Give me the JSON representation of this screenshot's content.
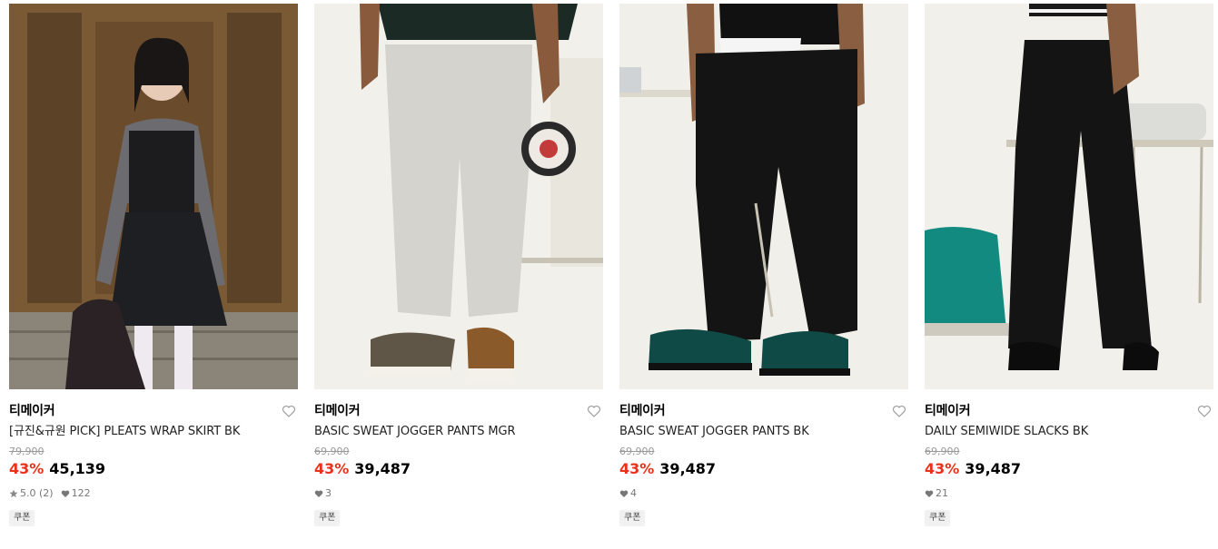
{
  "products": [
    {
      "brand": "티메이커",
      "title": "[규진&규원 PICK] PLEATS WRAP SKIRT BK",
      "original_price": "79,900",
      "discount_rate": "43%",
      "price": "45,139",
      "rating": "5.0",
      "review_count": "(2)",
      "likes": "122",
      "coupon_label": "쿠폰"
    },
    {
      "brand": "티메이커",
      "title": "BASIC SWEAT JOGGER PANTS MGR",
      "original_price": "69,900",
      "discount_rate": "43%",
      "price": "39,487",
      "likes": "3",
      "coupon_label": "쿠폰"
    },
    {
      "brand": "티메이커",
      "title": "BASIC SWEAT JOGGER PANTS BK",
      "original_price": "69,900",
      "discount_rate": "43%",
      "price": "39,487",
      "likes": "4",
      "coupon_label": "쿠폰"
    },
    {
      "brand": "티메이커",
      "title": "DAILY SEMIWIDE SLACKS BK",
      "original_price": "69,900",
      "discount_rate": "43%",
      "price": "39,487",
      "likes": "21",
      "coupon_label": "쿠폰"
    }
  ],
  "icons": {
    "wishlist": "heart-outline-icon",
    "likes": "heart-filled-icon",
    "rating": "star-icon"
  },
  "colors": {
    "discount": "#e8321b",
    "muted": "#999999"
  }
}
